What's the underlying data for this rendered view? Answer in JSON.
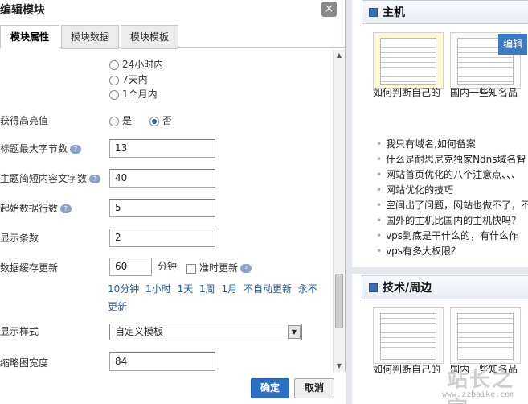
{
  "dialog": {
    "title": "编辑模块",
    "close_glyph": "×",
    "tabs": [
      {
        "label": "模块属性",
        "active": true
      },
      {
        "label": "模块数据",
        "active": false
      },
      {
        "label": "模块模板",
        "active": false
      }
    ]
  },
  "form": {
    "time_options": [
      {
        "label": "24小时内",
        "checked": false
      },
      {
        "label": "7天内",
        "checked": false
      },
      {
        "label": "1个月内",
        "checked": false
      }
    ],
    "get_highest": {
      "label": "获得高亮值",
      "options": [
        {
          "label": "是",
          "checked": false
        },
        {
          "label": "否",
          "checked": true
        }
      ]
    },
    "title_max_bytes": {
      "label": "标题最大字节数",
      "value": "13"
    },
    "summary_length": {
      "label": "主题简短内容文字数",
      "value": "40"
    },
    "start_row": {
      "label": "起始数据行数",
      "value": "5"
    },
    "show_count": {
      "label": "显示条数",
      "value": "2"
    },
    "cache_update": {
      "label": "数据缓存更新",
      "value": "60",
      "unit": "分钟",
      "timed_label": "准时更新",
      "timed_checked": false,
      "quick_options": [
        "10分钟",
        "1小时",
        "1天",
        "1周",
        "1月",
        "不自动更新",
        "永不更新"
      ]
    },
    "display_style": {
      "label": "显示样式",
      "selected": "自定义模板"
    },
    "thumb_width": {
      "label": "缩略图宽度",
      "value": "84"
    }
  },
  "footer": {
    "ok_label": "确定",
    "cancel_label": "取消"
  },
  "right_panel": {
    "section1": {
      "title": "主机",
      "thumbs": [
        {
          "caption": "如何判断自己的"
        },
        {
          "caption": "国内一些知名品"
        }
      ],
      "edit_label": "编辑",
      "news": [
        "我只有域名,如何备案",
        "什么是耐思尼克独家Ndns域名智",
        "网站首页优化的八个注意点、、、",
        "网站优化的技巧",
        "空间出了问题，网站也做不了，不",
        "国外的主机比国内的主机快吗？",
        "vps到底是干什么的，有什么作",
        "vps有多大权限？"
      ]
    },
    "section2": {
      "title": "技术/周边",
      "thumbs": [
        {
          "caption": "如何判断自己的"
        },
        {
          "caption": "国内一些知名品"
        }
      ]
    },
    "watermark": {
      "logo": "站长之家",
      "url": "www.zzbaike.com"
    }
  }
}
